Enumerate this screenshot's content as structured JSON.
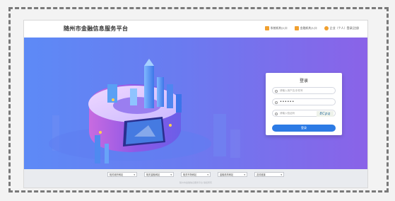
{
  "header": {
    "title": "随州市金融信息服务平台",
    "nav": [
      {
        "label": "系统机构入口",
        "icon": "building-icon",
        "color": "#f0a030"
      },
      {
        "label": "金融机构入口",
        "icon": "bank-icon",
        "color": "#f0a030"
      },
      {
        "label": "企业（个人）登录|注册",
        "icon": "user-icon",
        "color": "#f0a030"
      }
    ]
  },
  "login": {
    "title": "登录",
    "account_placeholder": "请输入用户名/手机号",
    "password_value": "••••••",
    "captcha_placeholder": "请输入验证码",
    "captcha_text": "8Cpq",
    "button_label": "登录"
  },
  "footer": {
    "links": [
      "相关政府网站",
      "相关金融网站",
      "相关市场网站",
      "金融机构网站",
      "友情链接"
    ],
    "copyright": "随州市金融信息服务平台 版权所有"
  },
  "colors": {
    "banner_start": "#5d8af6",
    "banner_end": "#8a63e8",
    "button": "#2c7be5"
  }
}
